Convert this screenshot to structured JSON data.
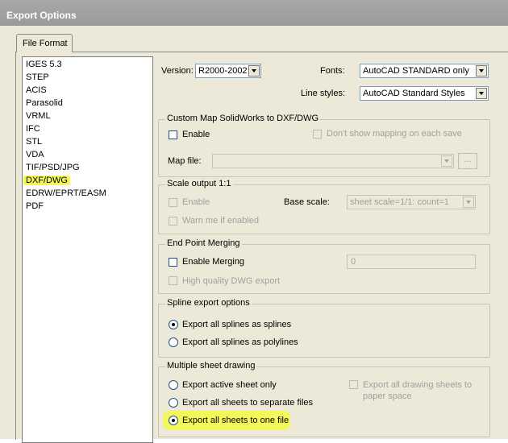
{
  "window": {
    "title": "Export Options"
  },
  "tabs": [
    {
      "label": "File Format"
    }
  ],
  "format_list": {
    "items": [
      "IGES 5.3",
      "STEP",
      "ACIS",
      "Parasolid",
      "VRML",
      "IFC",
      "STL",
      "VDA",
      "TIF/PSD/JPG",
      "DXF/DWG",
      "EDRW/EPRT/EASM",
      "PDF"
    ],
    "selected": "DXF/DWG"
  },
  "top": {
    "version_label": "Version:",
    "version_value": "R2000-2002",
    "fonts_label": "Fonts:",
    "fonts_value": "AutoCAD STANDARD only",
    "linestyles_label": "Line styles:",
    "linestyles_value": "AutoCAD Standard Styles"
  },
  "custom_map": {
    "title": "Custom Map SolidWorks to DXF/DWG",
    "enable_label": "Enable",
    "dont_show_label": "Don't show mapping on each save",
    "map_file_label": "Map file:",
    "map_file_value": "",
    "browse_label": "..."
  },
  "scale_output": {
    "title": "Scale output 1:1",
    "enable_label": "Enable",
    "base_scale_label": "Base scale:",
    "base_scale_value": "sheet scale=1/1: count=1",
    "warn_label": "Warn me if enabled"
  },
  "end_point": {
    "title": "End Point Merging",
    "enable_label": "Enable Merging",
    "value": "0",
    "hq_label": "High quality DWG export"
  },
  "spline": {
    "title": "Spline export options",
    "opt1": "Export all splines as splines",
    "opt2": "Export all splines as polylines"
  },
  "multisheet": {
    "title": "Multiple sheet drawing",
    "opt1": "Export active sheet only",
    "opt2": "Export all sheets to separate files",
    "opt3": "Export all sheets to one file",
    "paper_space_label": "Export all drawing sheets to paper space"
  },
  "colors": {
    "highlight": "#f3f75a",
    "window_bg": "#ece9d8"
  }
}
